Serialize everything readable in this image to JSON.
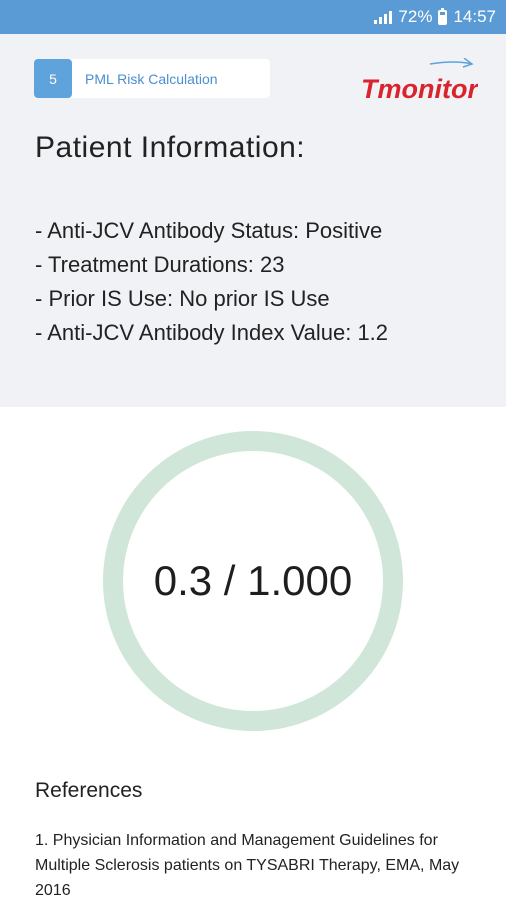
{
  "status_bar": {
    "battery_percent": "72%",
    "time": "14:57",
    "icons": [
      "signal-icon",
      "battery-icon"
    ]
  },
  "header": {
    "step_number": "5",
    "step_label": "PML Risk Calculation",
    "logo_text": "Tmonitor"
  },
  "patient_info": {
    "title": "Patient Information:",
    "lines": [
      "- Anti-JCV Antibody Status: Positive",
      "- Treatment Durations: 23",
      "- Prior IS Use: No prior IS Use",
      "- Anti-JCV Antibody Index Value: 1.2"
    ]
  },
  "risk": {
    "value": "0.3 / 1.000",
    "ring_color": "#cfe6d9"
  },
  "references": {
    "title": "References",
    "text": "1. Physician Information and Management Guidelines for Multiple Sclerosis patients on TYSABRI Therapy, EMA, May 2016"
  },
  "colors": {
    "status_bar": "#5a9bd5",
    "accent": "#5fa3dc",
    "logo_red": "#d9232d",
    "panel_bg": "#f1f2f6"
  }
}
